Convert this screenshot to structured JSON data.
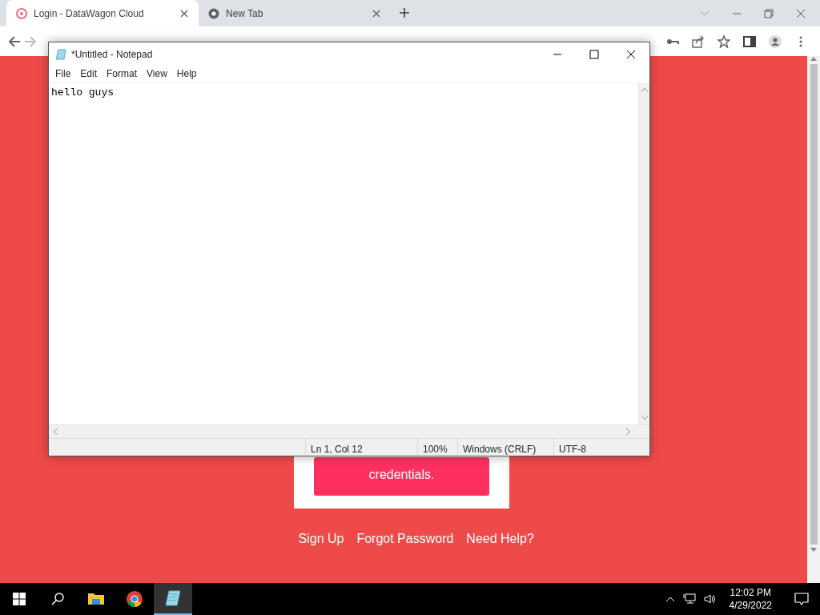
{
  "browser": {
    "tabs": [
      {
        "label": "Login - DataWagon Cloud",
        "selected": true
      },
      {
        "label": "New Tab",
        "selected": false
      }
    ]
  },
  "page": {
    "button_text": "credentials.",
    "links": [
      "Sign Up",
      "Forgot Password",
      "Need Help?"
    ]
  },
  "notepad": {
    "title": "*Untitled - Notepad",
    "menu": [
      "File",
      "Edit",
      "Format",
      "View",
      "Help"
    ],
    "content": "hello guys ",
    "status": [
      "Ln 1, Col 12",
      "100%",
      "Windows (CRLF)",
      "UTF-8"
    ]
  },
  "taskbar": {
    "apps": [
      {
        "kind": "explorer",
        "active": false
      },
      {
        "kind": "chrome",
        "active": false
      },
      {
        "kind": "notepad",
        "active": true
      }
    ],
    "time": "12:02 PM",
    "date": "4/29/2022"
  }
}
